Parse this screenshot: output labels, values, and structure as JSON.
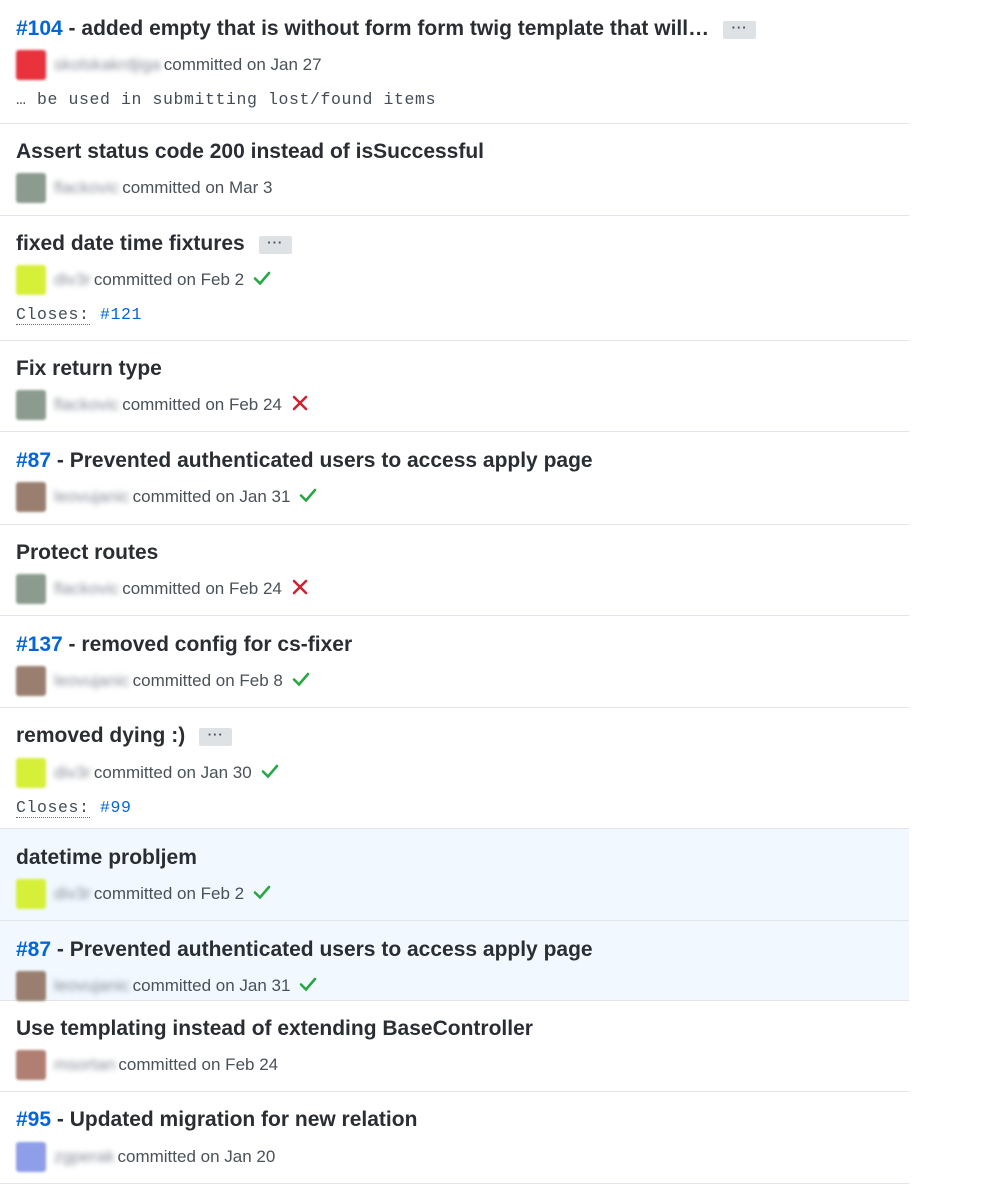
{
  "colors": {
    "link": "#0366d6",
    "success": "#28a745",
    "failure": "#cb2431",
    "highlight": "#f1f8ff"
  },
  "ellipsis_label": "···",
  "commits": [
    {
      "pr": "#104",
      "sep": " - ",
      "title": "added empty that is without form form twig template that will…",
      "has_ellipsis": true,
      "author": "skolskakrdjiga",
      "avatar_color": "#e8323c",
      "meta_text": "committed on Jan 27",
      "status": "none",
      "body": "… be used in submitting lost/found items"
    },
    {
      "pr": "",
      "sep": "",
      "title": "Assert status code 200 instead of isSuccessful",
      "has_ellipsis": false,
      "author": "flackovic",
      "avatar_color": "#8b9b8e",
      "meta_text": "committed on Mar 3",
      "status": "none"
    },
    {
      "pr": "",
      "sep": "",
      "title": "fixed date time fixtures",
      "has_ellipsis": true,
      "author": "div3r",
      "avatar_color": "#d6f03a",
      "meta_text": "committed on Feb 2",
      "status": "success",
      "closes_label": "Closes:",
      "closes_ref": "#121"
    },
    {
      "pr": "",
      "sep": "",
      "title": "Fix return type",
      "has_ellipsis": false,
      "author": "flackovic",
      "avatar_color": "#8b9b8e",
      "meta_text": "committed on Feb 24",
      "status": "failure"
    },
    {
      "pr": "#87",
      "sep": " - ",
      "title": "Prevented authenticated users to access apply page",
      "has_ellipsis": false,
      "author": "leovujanic",
      "avatar_color": "#9a7f70",
      "meta_text": "committed on Jan 31",
      "status": "success"
    },
    {
      "pr": "",
      "sep": "",
      "title": "Protect routes",
      "has_ellipsis": false,
      "author": "flackovic",
      "avatar_color": "#8b9b8e",
      "meta_text": "committed on Feb 24",
      "status": "failure"
    },
    {
      "pr": "#137",
      "sep": " - ",
      "title": "removed config for cs-fixer",
      "has_ellipsis": false,
      "author": "leovujanic",
      "avatar_color": "#9a7f70",
      "meta_text": "committed on Feb 8",
      "status": "success"
    },
    {
      "pr": "",
      "sep": "",
      "title": "removed dying :)",
      "has_ellipsis": true,
      "author": "div3r",
      "avatar_color": "#d6f03a",
      "meta_text": "committed on Jan 30",
      "status": "success",
      "closes_label": "Closes:",
      "closes_ref": "#99"
    },
    {
      "pr": "",
      "sep": "",
      "title": "datetime probljem",
      "has_ellipsis": false,
      "author": "div3r",
      "avatar_color": "#d6f03a",
      "meta_text": "committed on Feb 2",
      "status": "success",
      "highlighted": true
    },
    {
      "pr": "#87",
      "sep": " - ",
      "title": "Prevented authenticated users to access apply page",
      "has_ellipsis": false,
      "author": "leovujanic",
      "avatar_color": "#9a7f70",
      "meta_text": "committed on Jan 31",
      "status": "success",
      "highlighted": true
    },
    {
      "pr": "",
      "sep": "",
      "title": "Use templating instead of extending BaseController",
      "has_ellipsis": false,
      "author": "msortan",
      "avatar_color": "#b07f72",
      "meta_text": "committed on Feb 24",
      "status": "none"
    },
    {
      "pr": "#95",
      "sep": " - ",
      "title": "Updated migration for new relation",
      "has_ellipsis": false,
      "author": "zgperak",
      "avatar_color": "#8f9ee8",
      "meta_text": "committed on Jan 20",
      "status": "none"
    }
  ]
}
